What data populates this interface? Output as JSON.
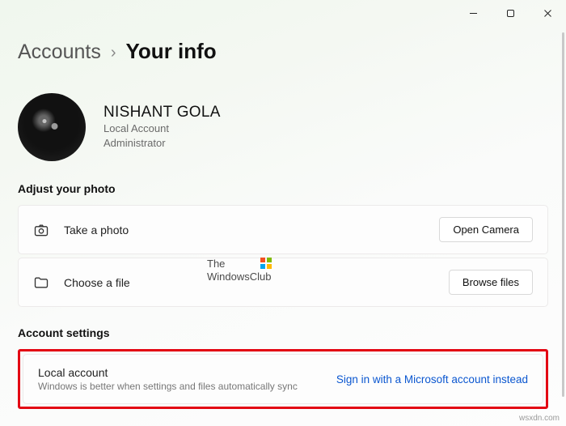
{
  "breadcrumb": {
    "parent": "Accounts",
    "current": "Your info"
  },
  "profile": {
    "name": "NISHANT GOLA",
    "type": "Local Account",
    "role": "Administrator"
  },
  "photo_section": {
    "title": "Adjust your photo",
    "rows": [
      {
        "icon": "camera",
        "label": "Take a photo",
        "button": "Open Camera"
      },
      {
        "icon": "folder",
        "label": "Choose a file",
        "button": "Browse files"
      }
    ]
  },
  "account_section": {
    "title": "Account settings",
    "card": {
      "title": "Local account",
      "subtitle": "Windows is better when settings and files automatically sync",
      "link": "Sign in with a Microsoft account instead"
    }
  },
  "watermark": {
    "line1": "The",
    "line2": "WindowsClub",
    "corner": "wsxdn.com"
  }
}
